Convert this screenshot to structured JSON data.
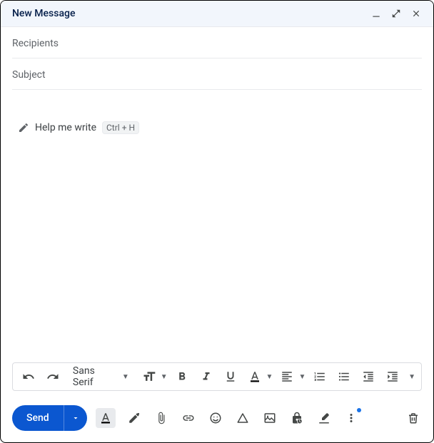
{
  "window": {
    "title": "New Message"
  },
  "fields": {
    "recipients_placeholder": "Recipients",
    "recipients_value": "",
    "subject_placeholder": "Subject",
    "subject_value": ""
  },
  "help_write": {
    "label": "Help me write",
    "shortcut": "Ctrl + H"
  },
  "formatting": {
    "font_family": "Sans Serif"
  },
  "actions": {
    "send_label": "Send"
  }
}
